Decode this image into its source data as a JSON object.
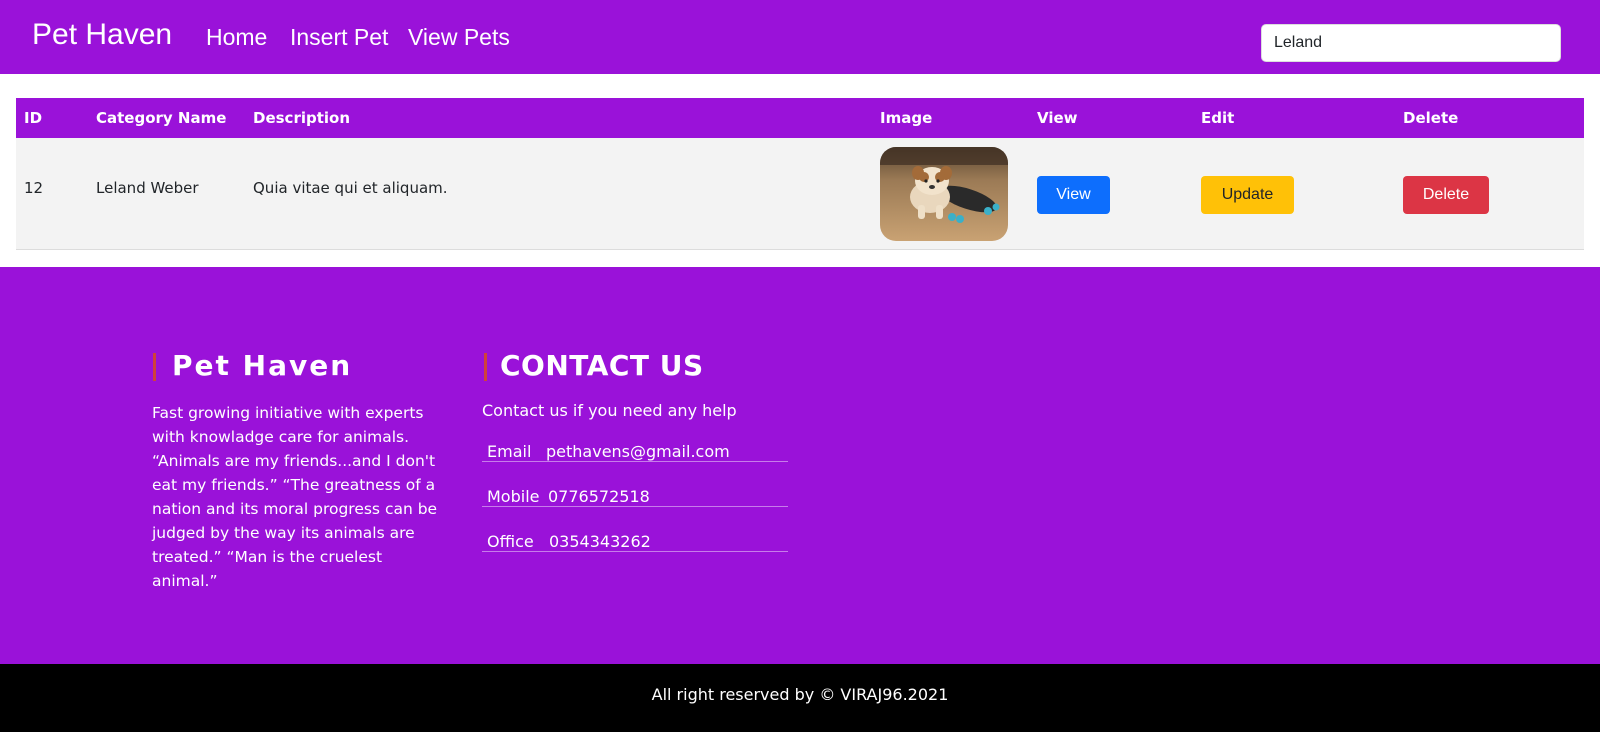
{
  "nav": {
    "brand": "Pet Haven",
    "links": [
      "Home",
      "Insert Pet",
      "View Pets"
    ],
    "search_value": "Leland"
  },
  "table": {
    "headers": [
      "ID",
      "Category Name",
      "Description",
      "Image",
      "View",
      "Edit",
      "Delete"
    ],
    "rows": [
      {
        "id": "12",
        "category_name": "Leland Weber",
        "description": "Quia vitae qui et aliquam.",
        "image": "puppy-on-skateboard",
        "view_label": "View",
        "edit_label": "Update",
        "delete_label": "Delete"
      }
    ]
  },
  "footer": {
    "about_title": "Pet Haven",
    "about_text": "Fast growing initiative with experts with knowladge care for animals. “Animals are my friends...and I don't eat my friends.” “The greatness of a nation and its moral progress can be judged by the way its animals are treated.” “Man is the cruelest animal.”",
    "contact_title": "CONTACT US",
    "contact_sub": "Contact us if you need any help",
    "contacts": [
      {
        "label": "Email",
        "value": "pethavens@gmail.com"
      },
      {
        "label": "Mobile",
        "value": "0776572518"
      },
      {
        "label": "Office",
        "value": "0354343262"
      }
    ]
  },
  "copyright": "All right reserved by © VIRAJ96.2021",
  "colors": {
    "primary": "#9a12d9",
    "view_button": "#0d6efd",
    "update_button": "#ffc107",
    "delete_button": "#dc3545",
    "title_accent": "#d0413b"
  }
}
